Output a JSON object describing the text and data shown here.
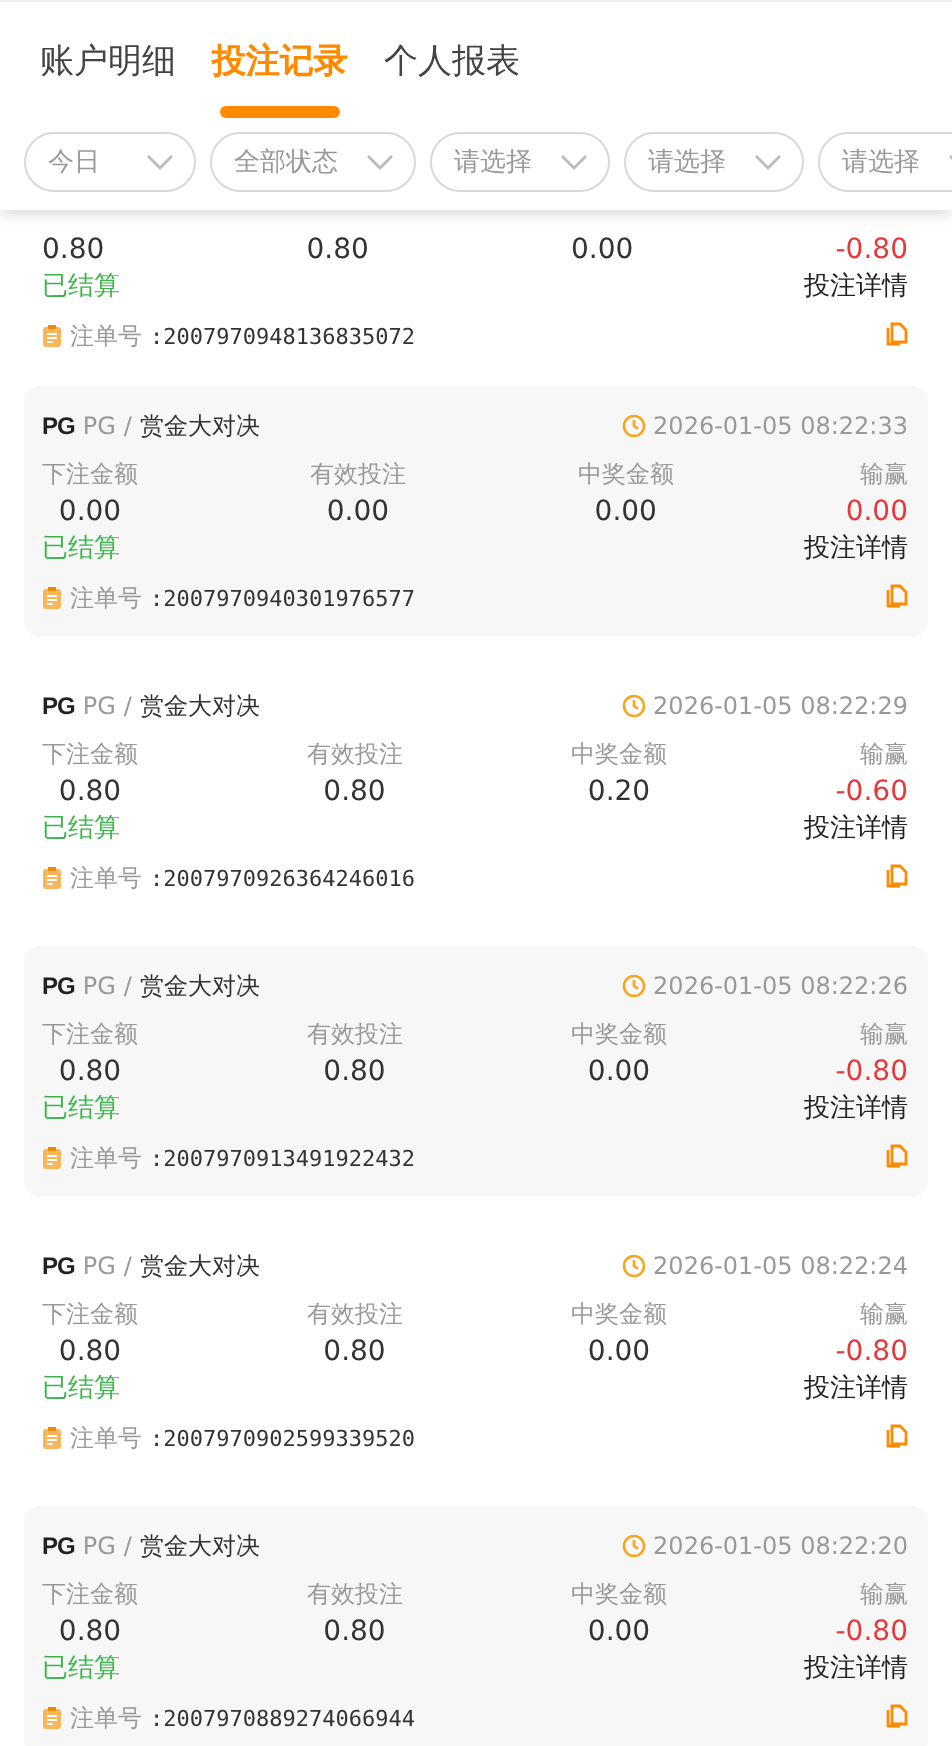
{
  "tabs": [
    {
      "label": "账户明细",
      "selected": false
    },
    {
      "label": "投注记录",
      "selected": true
    },
    {
      "label": "个人报表",
      "selected": false
    }
  ],
  "filters": [
    "今日",
    "全部状态",
    "请选择",
    "请选择",
    "请选择"
  ],
  "records": [
    {
      "partial": true,
      "values": [
        "0.80",
        "0.80",
        "0.00",
        "-0.80"
      ],
      "status": "已结算",
      "detail": "投注详情",
      "order_label": "注单号",
      "order_no": ":2007970948136835072"
    },
    {
      "partial": false,
      "logo": "PG",
      "provider": "PG",
      "separator": "/",
      "game": "赏金大对决",
      "time": "2026-01-05 08:22:33",
      "labels": [
        "下注金额",
        "有效投注",
        "中奖金额",
        "输赢"
      ],
      "values": [
        "0.00",
        "0.00",
        "0.00",
        "0.00"
      ],
      "status": "已结算",
      "detail": "投注详情",
      "order_label": "注单号",
      "order_no": ":2007970940301976577"
    },
    {
      "partial": false,
      "logo": "PG",
      "provider": "PG",
      "separator": "/",
      "game": "赏金大对决",
      "time": "2026-01-05 08:22:29",
      "labels": [
        "下注金额",
        "有效投注",
        "中奖金额",
        "输赢"
      ],
      "values": [
        "0.80",
        "0.80",
        "0.20",
        "-0.60"
      ],
      "status": "已结算",
      "detail": "投注详情",
      "order_label": "注单号",
      "order_no": ":2007970926364246016"
    },
    {
      "partial": false,
      "logo": "PG",
      "provider": "PG",
      "separator": "/",
      "game": "赏金大对决",
      "time": "2026-01-05 08:22:26",
      "labels": [
        "下注金额",
        "有效投注",
        "中奖金额",
        "输赢"
      ],
      "values": [
        "0.80",
        "0.80",
        "0.00",
        "-0.80"
      ],
      "status": "已结算",
      "detail": "投注详情",
      "order_label": "注单号",
      "order_no": ":2007970913491922432"
    },
    {
      "partial": false,
      "logo": "PG",
      "provider": "PG",
      "separator": "/",
      "game": "赏金大对决",
      "time": "2026-01-05 08:22:24",
      "labels": [
        "下注金额",
        "有效投注",
        "中奖金额",
        "输赢"
      ],
      "values": [
        "0.80",
        "0.80",
        "0.00",
        "-0.80"
      ],
      "status": "已结算",
      "detail": "投注详情",
      "order_label": "注单号",
      "order_no": ":2007970902599339520"
    },
    {
      "partial": false,
      "logo": "PG",
      "provider": "PG",
      "separator": "/",
      "game": "赏金大对决",
      "time": "2026-01-05 08:22:20",
      "labels": [
        "下注金额",
        "有效投注",
        "中奖金额",
        "输赢"
      ],
      "values": [
        "0.80",
        "0.80",
        "0.00",
        "-0.80"
      ],
      "status": "已结算",
      "detail": "投注详情",
      "order_label": "注单号",
      "order_no": ":2007970889274066944"
    }
  ]
}
